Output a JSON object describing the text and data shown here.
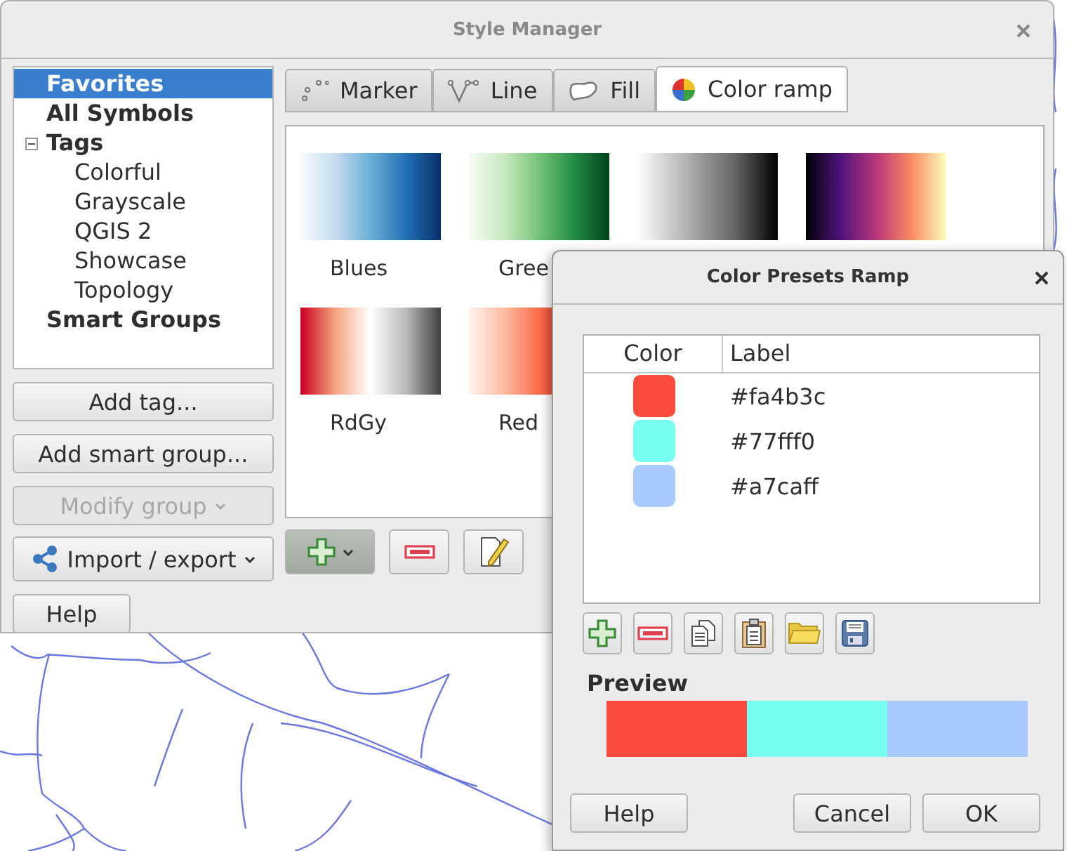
{
  "style_manager": {
    "title": "Style Manager",
    "tree": [
      {
        "label": "Favorites",
        "selected": true
      },
      {
        "label": "All Symbols",
        "selected": false
      },
      {
        "label": "Tags",
        "selected": false,
        "expanded": true,
        "children": [
          {
            "label": "Colorful",
            "selected": false
          },
          {
            "label": "Grayscale",
            "selected": false
          },
          {
            "label": "QGIS 2",
            "selected": false
          },
          {
            "label": "Showcase",
            "selected": false
          },
          {
            "label": "Topology",
            "selected": false
          }
        ]
      },
      {
        "label": "Smart Groups",
        "selected": false
      }
    ],
    "side_buttons": [
      {
        "label": "Add tag...",
        "kind": "button",
        "disabled": false
      },
      {
        "label": "Add smart group...",
        "kind": "button",
        "disabled": false
      },
      {
        "label": "Modify group",
        "kind": "dropdown",
        "disabled": true
      },
      {
        "label": "Import / export",
        "kind": "share-dropdown",
        "disabled": false
      }
    ],
    "help_button": "Help",
    "tabs": [
      {
        "label": "Marker",
        "kind": "marker",
        "selected": false
      },
      {
        "label": "Line",
        "kind": "line",
        "selected": false
      },
      {
        "label": "Fill",
        "kind": "fill",
        "selected": false
      },
      {
        "label": "Color ramp",
        "kind": "ramp",
        "selected": true
      }
    ],
    "ramps": [
      {
        "kind": "blues",
        "label": "Blues"
      },
      {
        "kind": "greens",
        "label": "Gree"
      },
      {
        "kind": "greys"
      },
      {
        "kind": "magma"
      },
      {
        "kind": "rdgy",
        "label": "RdGy"
      },
      {
        "kind": "reds",
        "label": "Red"
      }
    ]
  },
  "color_presets_dialog": {
    "title": "Color Presets Ramp",
    "columns": [
      "Color",
      "Label"
    ],
    "rows": [
      {
        "color": "#fa4b3c",
        "label": "#fa4b3c"
      },
      {
        "color": "#77fff0",
        "label": "#77fff0"
      },
      {
        "color": "#a7caff",
        "label": "#a7caff"
      }
    ],
    "preview_label": "Preview",
    "buttons": [
      {
        "label": "Help",
        "kind": "help"
      },
      {
        "label": "Cancel",
        "kind": "cancel"
      },
      {
        "label": "OK",
        "kind": "ok"
      }
    ]
  }
}
